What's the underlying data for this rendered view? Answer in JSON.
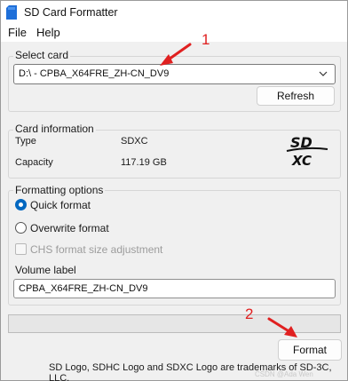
{
  "window": {
    "title": "SD Card Formatter"
  },
  "menu": {
    "file": "File",
    "help": "Help"
  },
  "select_card": {
    "label": "Select card",
    "value": "D:\\ - CPBA_X64FRE_ZH-CN_DV9",
    "refresh_label": "Refresh"
  },
  "card_info": {
    "label": "Card information",
    "type_label": "Type",
    "type_value": "SDXC",
    "capacity_label": "Capacity",
    "capacity_value": "117.19 GB",
    "logo_top": "SD",
    "logo_bottom": "XC"
  },
  "formatting": {
    "label": "Formatting options",
    "quick": "Quick format",
    "overwrite": "Overwrite format",
    "chs": "CHS format size adjustment",
    "volume_label": "Volume label",
    "volume_value": "CPBA_X64FRE_ZH-CN_DV9",
    "selected": "quick"
  },
  "progress": {
    "value": 0
  },
  "format_button": "Format",
  "footer": "SD Logo, SDHC Logo and SDXC Logo are trademarks of SD-3C, LLC.",
  "annotations": {
    "one": "1",
    "two": "2",
    "color": "#e02020"
  },
  "watermark": "CSDN @Ada Wen"
}
